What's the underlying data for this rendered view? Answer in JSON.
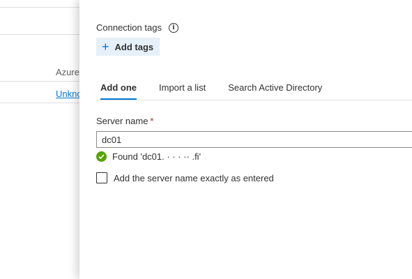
{
  "background": {
    "column_header": "Azure",
    "row_link": "Unkno"
  },
  "panel": {
    "connection_tags_label": "Connection tags",
    "add_tags_label": "Add tags",
    "tabs": [
      {
        "label": "Add one",
        "active": true
      },
      {
        "label": "Import a list",
        "active": false
      },
      {
        "label": "Search Active Directory",
        "active": false
      }
    ],
    "server_name_label": "Server name",
    "required_marker": "*",
    "server_name_value": "dc01",
    "found_message": "Found 'dc01.  ·  ·  ·  ··  .fi'",
    "exact_checkbox_label": "Add the server name exactly as entered",
    "exact_checkbox_checked": false
  },
  "colors": {
    "accent": "#0078d4",
    "success": "#57a300",
    "required": "#a4262c",
    "add_tags_bg": "#e6f0fa"
  },
  "icons": {
    "info": "info-icon",
    "plus": "plus-icon",
    "success": "check-circle-icon"
  }
}
